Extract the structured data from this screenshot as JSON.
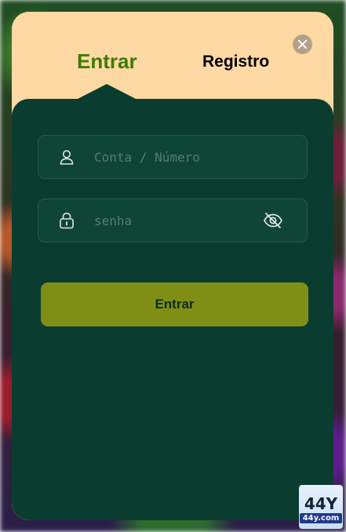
{
  "tabs": {
    "login": "Entrar",
    "register": "Registro"
  },
  "form": {
    "account_placeholder": "Conta / Número",
    "password_placeholder": "senha",
    "submit_label": "Entrar"
  },
  "icons": {
    "close": "close-icon",
    "user": "user-icon",
    "lock": "lock-icon",
    "eye_off": "eye-off-icon"
  },
  "watermark": {
    "big": "44Y",
    "small": "44y.com"
  },
  "colors": {
    "modal_bg": "#fed9a4",
    "panel_bg": "#0a3d30",
    "active_tab": "#3e7a05",
    "button_bg": "#7f8f16"
  }
}
